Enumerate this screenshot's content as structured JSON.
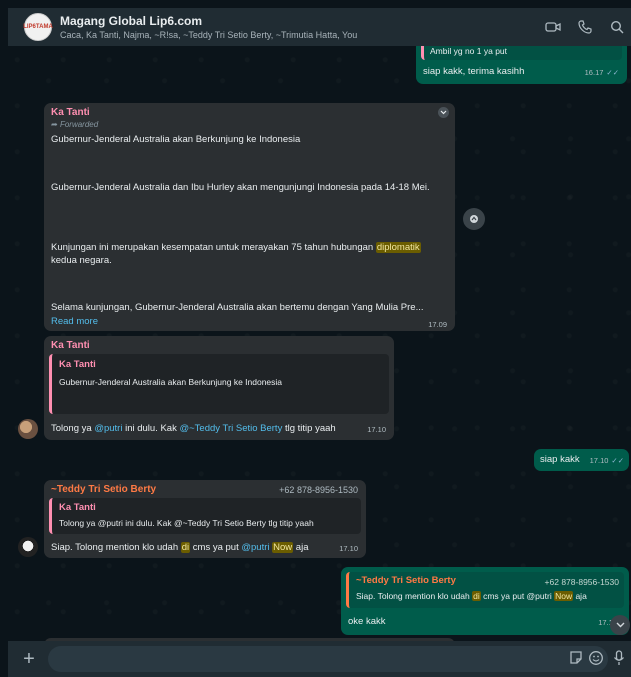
{
  "header": {
    "avatar_text": "LIP6TAMA",
    "title": "Magang Global Lip6.com",
    "members": "Caca, Ka Tanti, Najma, ~R!sa, ~Teddy Tri Setio Berty, ~Trimutia Hatta, You"
  },
  "messages": {
    "m0": {
      "quoted": "Ambil yg no 1 ya put",
      "text": "siap kakk, terima kasihh",
      "time": "16.17"
    },
    "m1": {
      "sender": "Ka Tanti",
      "forwarded": "Forwarded",
      "p1": "Gubernur-Jenderal Australia akan Berkunjung ke Indonesia",
      "p2": "Gubernur-Jenderal Australia dan Ibu Hurley akan mengunjungi Indonesia pada 14-18 Mei.",
      "p3a": "Kunjungan ini merupakan kesempatan untuk merayakan 75 tahun hubungan ",
      "p3hl": "diplomatik",
      "p3b": " kedua negara.",
      "p4": "Selama kunjungan, Gubernur-Jenderal Australia akan bertemu dengan Yang Mulia Pre...",
      "readmore": "Read more",
      "time": "17.09"
    },
    "m2": {
      "sender": "Ka Tanti",
      "quote_sender": "Ka Tanti",
      "quote_text": "Gubernur-Jenderal Australia akan Berkunjung ke Indonesia",
      "t1": "Tolong ya ",
      "mention1": "@putri",
      "t2": "  ini dulu. Kak ",
      "mention2": "@~Teddy Tri Setio Berty",
      "t3": " tlg titip yaah",
      "time": "17.10"
    },
    "m3": {
      "text": "siap kakk",
      "time": "17.10"
    },
    "m4": {
      "sender": "~Teddy Tri Setio Berty",
      "phone": "+62 878-8956-1530",
      "quote_sender": "Ka Tanti",
      "quote_text": "Tolong ya @putri  ini dulu. Kak @~Teddy Tri Setio Berty tlg titip yaah",
      "t1": "Siap. Tolong mention klo udah ",
      "hl1": "di",
      "t2": " cms ya put ",
      "mention": "@putri",
      "t3": "  ",
      "hl2": "Now",
      "t4": " aja",
      "time": "17.10"
    },
    "m5": {
      "quote_sender": "~Teddy Tri Setio Berty",
      "quote_phone": "+62 878-8956-1530",
      "q1": "Siap. Tolong mention klo udah ",
      "qhl1": "di",
      "q2": " cms ya put @putri  ",
      "qhl2": "Now",
      "q3": " aja",
      "text": "oke kakk",
      "time": "17.10"
    }
  },
  "footer": {
    "plus": "+"
  },
  "colors": {
    "outgoing": "#005c4b",
    "incoming": "#2b2f32",
    "header": "#202c33",
    "accent": "#53bdeb"
  }
}
